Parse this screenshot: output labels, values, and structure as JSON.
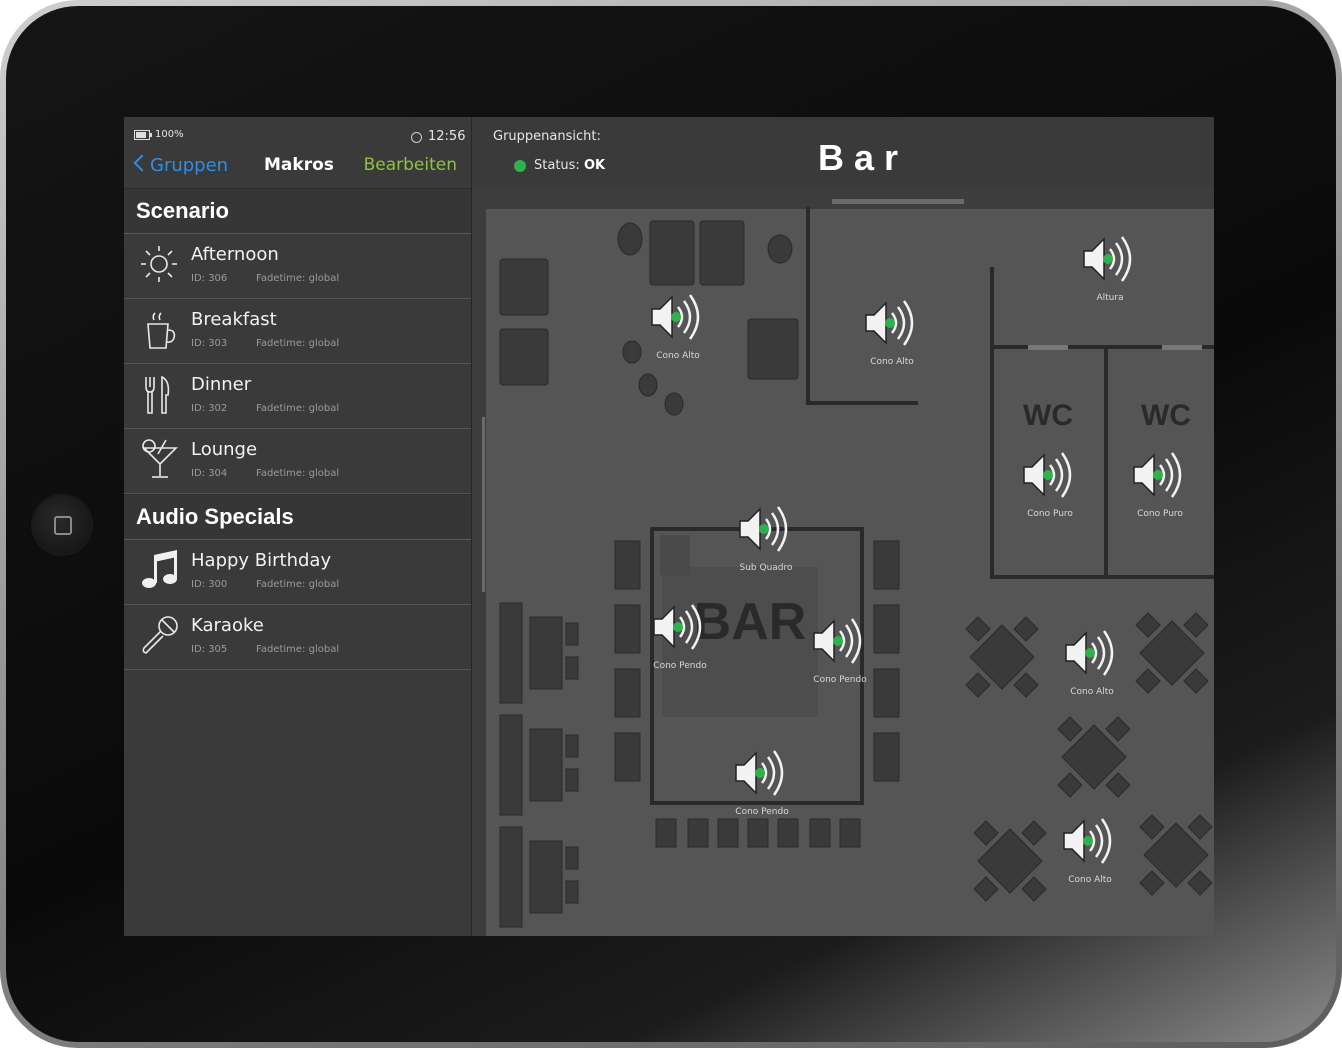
{
  "status_bar": {
    "battery": "100%",
    "time": "12:56"
  },
  "nav": {
    "back": "Gruppen",
    "title": "Makros",
    "edit": "Bearbeiten"
  },
  "sections": {
    "scenario": "Scenario",
    "audio_specials": "Audio Specials"
  },
  "scenario_items": [
    {
      "name": "Afternoon",
      "id": "ID: 306",
      "fadetime": "Fadetime: global",
      "icon": "sun-icon"
    },
    {
      "name": "Breakfast",
      "id": "ID: 303",
      "fadetime": "Fadetime: global",
      "icon": "coffee-cup-icon"
    },
    {
      "name": "Dinner",
      "id": "ID: 302",
      "fadetime": "Fadetime: global",
      "icon": "fork-knife-icon"
    },
    {
      "name": "Lounge",
      "id": "ID: 304",
      "fadetime": "Fadetime: global",
      "icon": "cocktail-icon"
    }
  ],
  "audio_items": [
    {
      "name": "Happy Birthday",
      "id": "ID: 300",
      "fadetime": "Fadetime: global",
      "icon": "music-note-icon"
    },
    {
      "name": "Karaoke",
      "id": "ID: 305",
      "fadetime": "Fadetime: global",
      "icon": "microphone-icon"
    }
  ],
  "header": {
    "group_label": "Gruppenansicht:",
    "status_label": "Status:",
    "status_value": "OK",
    "title": "Bar",
    "status_color": "#2fb14b"
  },
  "map": {
    "room_labels": {
      "wc1": "WC",
      "wc2": "WC",
      "bar": "BAR"
    },
    "speakers": [
      "Cono Alto",
      "Cono Alto",
      "Altura",
      "Cono Puro",
      "Cono Puro",
      "Sub Quadro",
      "Cono Pendo",
      "Cono Pendo",
      "Cono Pendo",
      "Cono Alto",
      "Cono Alto"
    ]
  },
  "colors": {
    "accent_blue": "#2e8fe6",
    "accent_green": "#8cc43c",
    "speaker_dot": "#2fb14b"
  }
}
